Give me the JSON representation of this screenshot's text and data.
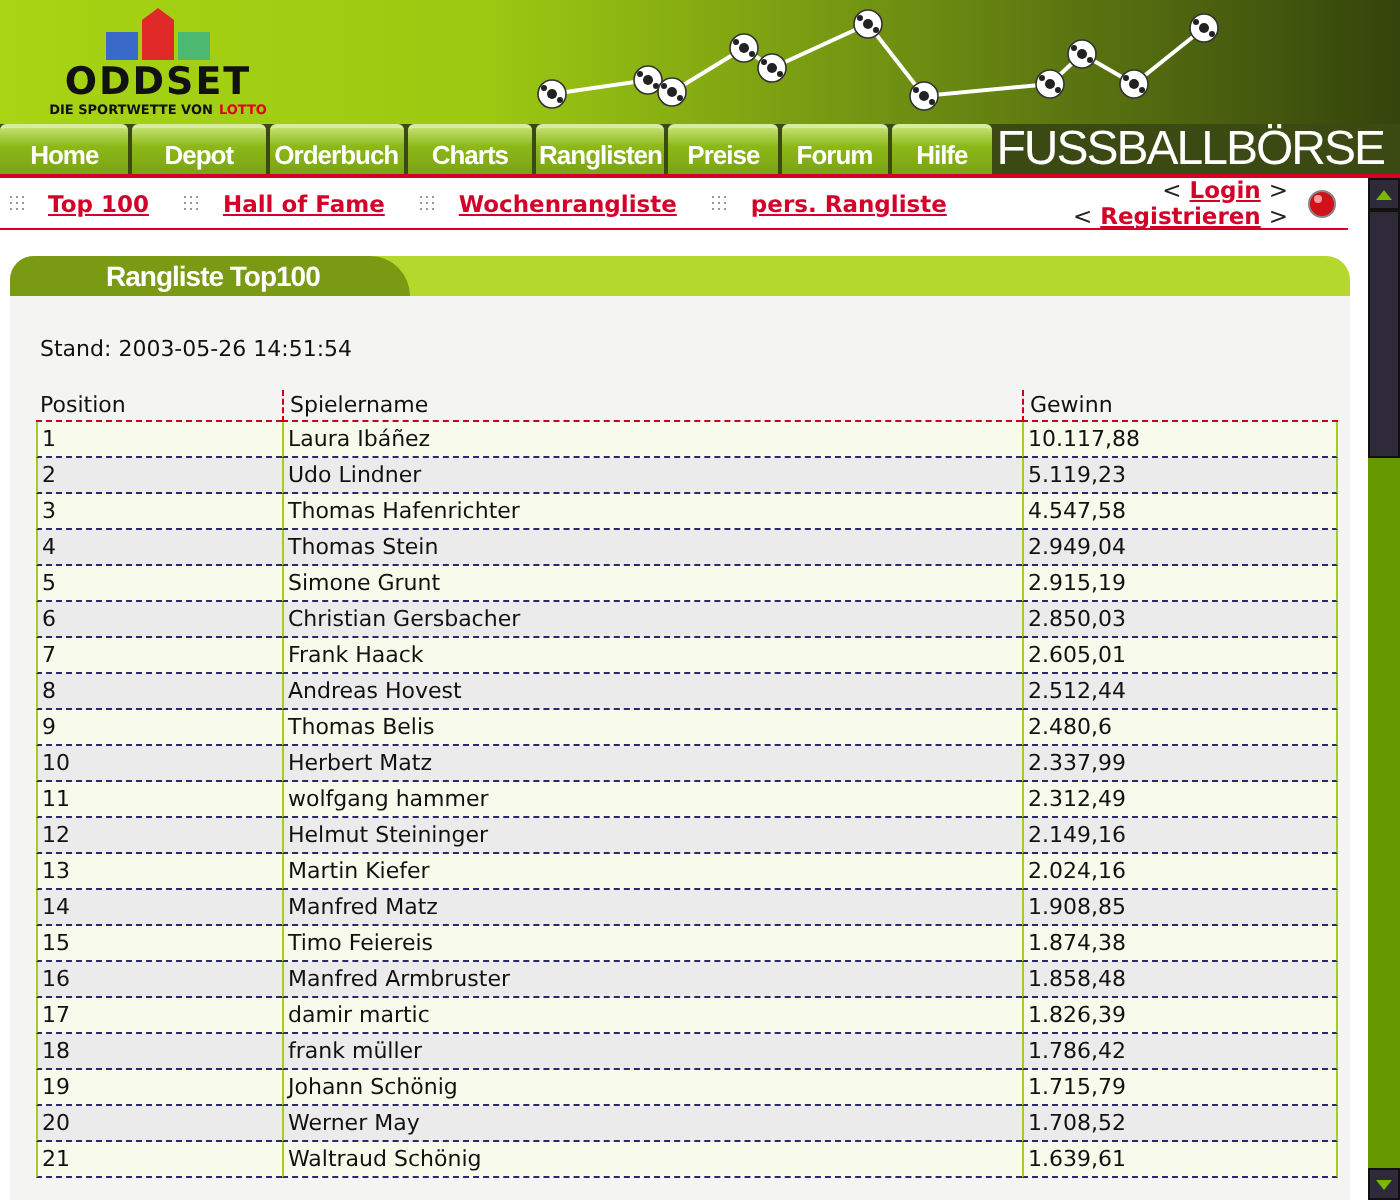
{
  "logo": {
    "name": "ODDSET",
    "tagline": "DIE SPORTWETTE VON",
    "brand": "LOTTO"
  },
  "nav": [
    {
      "label": "Home"
    },
    {
      "label": "Depot"
    },
    {
      "label": "Orderbuch"
    },
    {
      "label": "Charts"
    },
    {
      "label": "Ranglisten"
    },
    {
      "label": "Preise"
    },
    {
      "label": "Forum"
    },
    {
      "label": "Hilfe"
    }
  ],
  "site_title": "FUSSBALLBÖRSE",
  "subnav": [
    {
      "label": "Top 100"
    },
    {
      "label": "Hall of Fame"
    },
    {
      "label": "Wochenrangliste"
    },
    {
      "label": "pers. Rangliste"
    }
  ],
  "account_links": [
    {
      "before": "<",
      "label": "Login",
      "after": ">"
    },
    {
      "before": "<",
      "label": "Registrieren",
      "after": ">"
    }
  ],
  "panel": {
    "title": "Rangliste Top100",
    "stand": "Stand: 2003-05-26 14:51:54"
  },
  "table": {
    "columns": [
      "Position",
      "Spielername",
      "Gewinn"
    ],
    "rows": [
      [
        "1",
        "Laura Ibáñez",
        "10.117,88"
      ],
      [
        "2",
        "Udo Lindner",
        "5.119,23"
      ],
      [
        "3",
        "Thomas Hafenrichter",
        "4.547,58"
      ],
      [
        "4",
        "Thomas Stein",
        "2.949,04"
      ],
      [
        "5",
        "Simone Grunt",
        "2.915,19"
      ],
      [
        "6",
        "Christian Gersbacher",
        "2.850,03"
      ],
      [
        "7",
        "Frank Haack",
        "2.605,01"
      ],
      [
        "8",
        "Andreas Hovest",
        "2.512,44"
      ],
      [
        "9",
        "Thomas Belis",
        "2.480,6"
      ],
      [
        "10",
        "Herbert Matz",
        "2.337,99"
      ],
      [
        "11",
        "wolfgang hammer",
        "2.312,49"
      ],
      [
        "12",
        "Helmut Steininger",
        "2.149,16"
      ],
      [
        "13",
        "Martin Kiefer",
        "2.024,16"
      ],
      [
        "14",
        "Manfred Matz",
        "1.908,85"
      ],
      [
        "15",
        "Timo Feiereis",
        "1.874,38"
      ],
      [
        "16",
        "Manfred Armbruster",
        "1.858,48"
      ],
      [
        "17",
        "damir martic",
        "1.826,39"
      ],
      [
        "18",
        "frank müller",
        "1.786,42"
      ],
      [
        "19",
        "Johann Schönig",
        "1.715,79"
      ],
      [
        "20",
        "Werner May",
        "1.708,52"
      ],
      [
        "21",
        "Waltraud Schönig",
        "1.639,61"
      ]
    ]
  }
}
